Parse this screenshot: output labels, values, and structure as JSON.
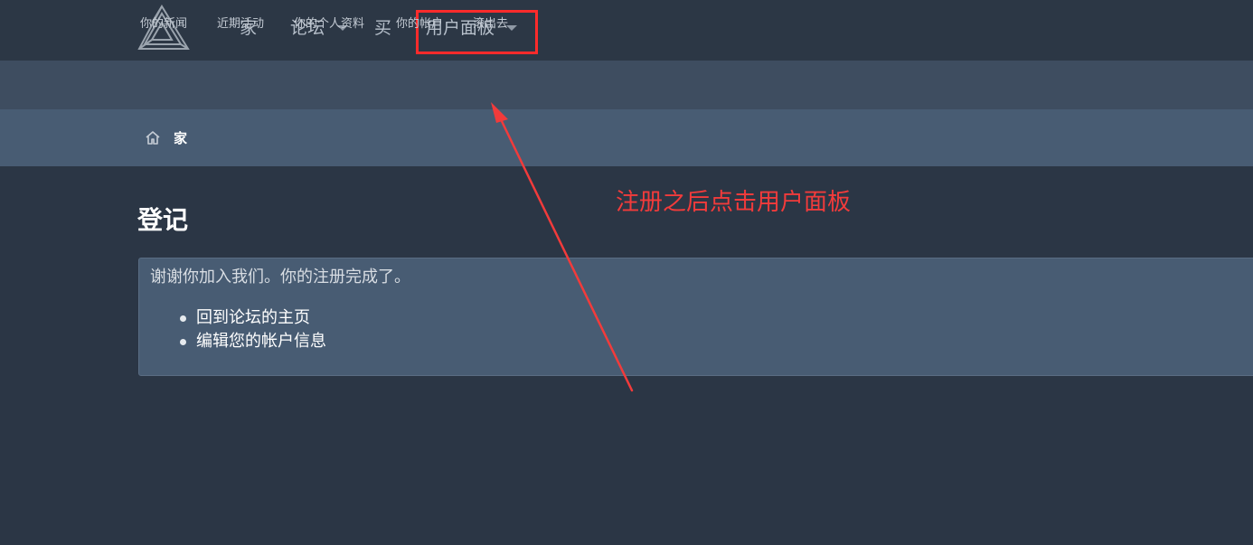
{
  "topnav": {
    "items": [
      {
        "label": "家"
      },
      {
        "label": "论坛"
      },
      {
        "label": "买"
      },
      {
        "label": "用户面板"
      }
    ]
  },
  "subnav": {
    "items": [
      {
        "label": "你的新闻"
      },
      {
        "label": "近期活动"
      },
      {
        "label": "你的个人资料"
      },
      {
        "label": "你的帐户"
      },
      {
        "label": "滚出去"
      }
    ]
  },
  "breadcrumb": {
    "home_label": "家"
  },
  "main": {
    "title": "登记",
    "message": "谢谢你加入我们。你的注册完成了。",
    "links": [
      {
        "label": "回到论坛的主页"
      },
      {
        "label": "编辑您的帐户信息"
      }
    ]
  },
  "annotation": {
    "text": "注册之后点击用户面板",
    "color": "#f23b3b"
  },
  "colors": {
    "background": "#2b3645",
    "subnav": "#3e4d60",
    "breadcrumb_bar": "#485c73",
    "highlight": "#ff2b2b"
  },
  "icons": {
    "logo": "penrose-triangle-logo",
    "home": "home-icon",
    "dropdown": "caret-down-icon"
  }
}
